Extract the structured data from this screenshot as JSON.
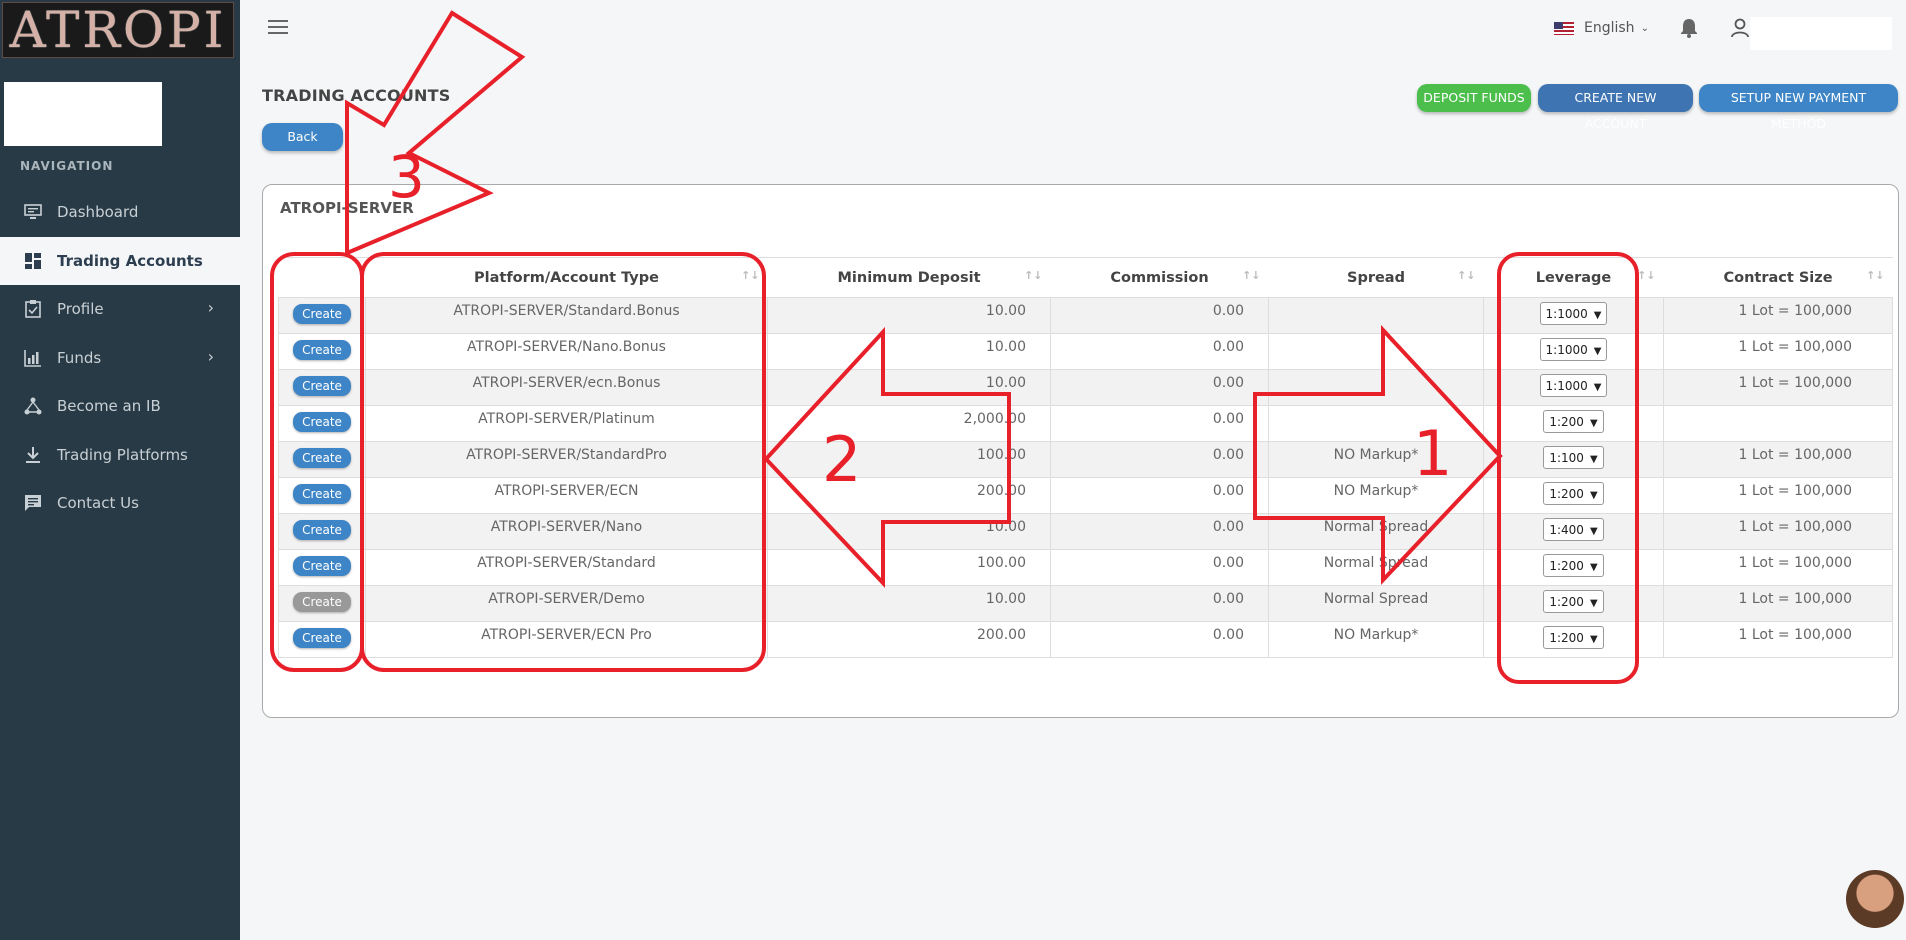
{
  "brand": {
    "logo_text": "ATROPI"
  },
  "sidebar": {
    "nav_title": "NAVIGATION",
    "items": [
      {
        "label": "Dashboard",
        "icon": "monitor-icon"
      },
      {
        "label": "Trading Accounts",
        "icon": "grid-icon",
        "active": true
      },
      {
        "label": "Profile",
        "icon": "clipboard-icon",
        "has_chevron": true
      },
      {
        "label": "Funds",
        "icon": "chart-icon",
        "has_chevron": true
      },
      {
        "label": "Become an IB",
        "icon": "network-icon"
      },
      {
        "label": "Trading Platforms",
        "icon": "download-icon"
      },
      {
        "label": "Contact Us",
        "icon": "message-icon"
      }
    ]
  },
  "topbar": {
    "language": "English"
  },
  "page": {
    "title": "TRADING ACCOUNTS",
    "back_label": "Back",
    "deposit_label": "DEPOSIT FUNDS",
    "create_account_label": "CREATE NEW ACCOUNT",
    "setup_payment_label": "SETUP NEW PAYMENT METHOD"
  },
  "card": {
    "title": "ATROPI-SERVER"
  },
  "table": {
    "headers": [
      "Platform/Account Type",
      "Minimum Deposit",
      "Commission",
      "Spread",
      "Leverage",
      "Contract Size"
    ],
    "create_label": "Create",
    "rows": [
      {
        "platform": "ATROPI-SERVER/Standard.Bonus",
        "min_deposit": "10.00",
        "commission": "0.00",
        "spread": "",
        "leverage": "1:1000",
        "contract": "1 Lot = 100,000"
      },
      {
        "platform": "ATROPI-SERVER/Nano.Bonus",
        "min_deposit": "10.00",
        "commission": "0.00",
        "spread": "",
        "leverage": "1:1000",
        "contract": "1 Lot = 100,000"
      },
      {
        "platform": "ATROPI-SERVER/ecn.Bonus",
        "min_deposit": "10.00",
        "commission": "0.00",
        "spread": "",
        "leverage": "1:1000",
        "contract": "1 Lot = 100,000"
      },
      {
        "platform": "ATROPI-SERVER/Platinum",
        "min_deposit": "2,000.00",
        "commission": "0.00",
        "spread": "",
        "leverage": "1:200",
        "contract": ""
      },
      {
        "platform": "ATROPI-SERVER/StandardPro",
        "min_deposit": "100.00",
        "commission": "0.00",
        "spread": "NO Markup*",
        "leverage": "1:100",
        "contract": "1 Lot = 100,000"
      },
      {
        "platform": "ATROPI-SERVER/ECN",
        "min_deposit": "200.00",
        "commission": "0.00",
        "spread": "NO Markup*",
        "leverage": "1:200",
        "contract": "1 Lot = 100,000"
      },
      {
        "platform": "ATROPI-SERVER/Nano",
        "min_deposit": "10.00",
        "commission": "0.00",
        "spread": "Normal Spread",
        "leverage": "1:400",
        "contract": "1 Lot = 100,000"
      },
      {
        "platform": "ATROPI-SERVER/Standard",
        "min_deposit": "100.00",
        "commission": "0.00",
        "spread": "Normal Spread",
        "leverage": "1:200",
        "contract": "1 Lot = 100,000"
      },
      {
        "platform": "ATROPI-SERVER/Demo",
        "min_deposit": "10.00",
        "commission": "0.00",
        "spread": "Normal Spread",
        "leverage": "1:200",
        "contract": "1 Lot = 100,000",
        "create_disabled": true
      },
      {
        "platform": "ATROPI-SERVER/ECN Pro",
        "min_deposit": "200.00",
        "commission": "0.00",
        "spread": "NO Markup*",
        "leverage": "1:200",
        "contract": "1 Lot = 100,000"
      }
    ]
  },
  "annotations": {
    "labels": [
      "1",
      "2",
      "3"
    ],
    "color": "#e8202a"
  }
}
